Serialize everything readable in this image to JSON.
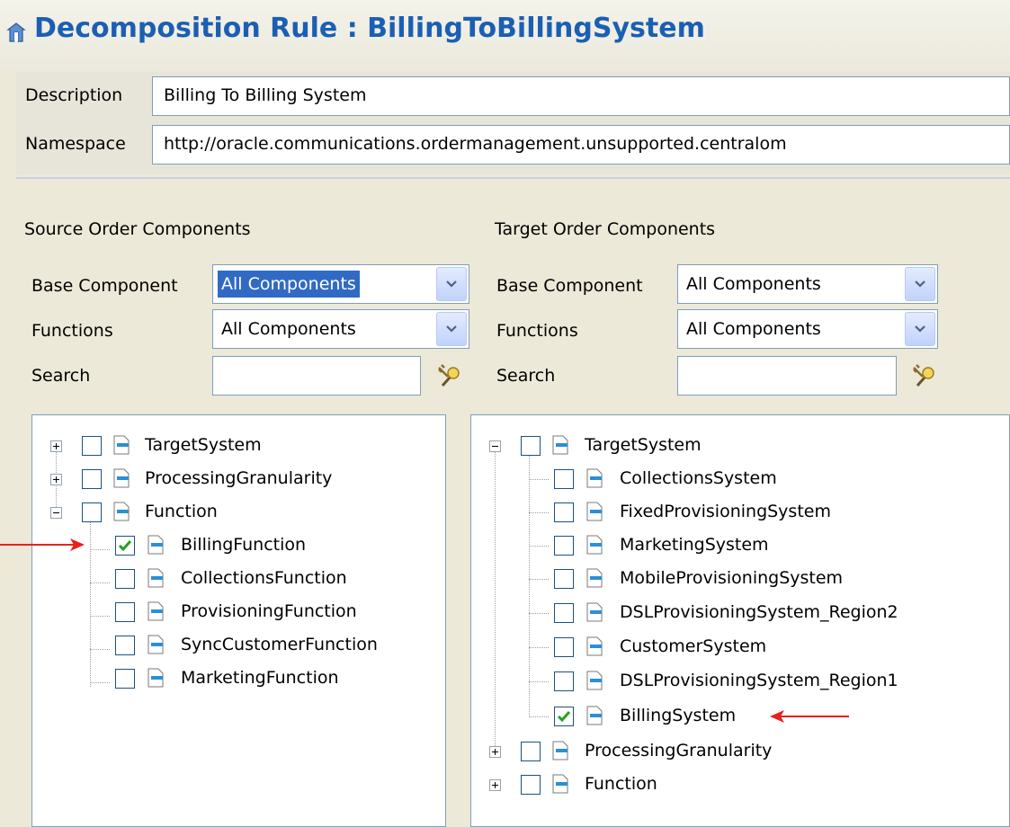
{
  "header": {
    "title": "Decomposition Rule : BillingToBillingSystem",
    "title_icon": "decomposition-rule-icon",
    "title_color": "#1b5fb4"
  },
  "form": {
    "description_label": "Description",
    "description_value": "Billing To Billing System",
    "namespace_label": "Namespace",
    "namespace_value": "http://oracle.communications.ordermanagement.unsupported.centralom"
  },
  "source": {
    "heading": "Source Order Components",
    "base_component_label": "Base Component",
    "base_component_value": "All Components",
    "functions_label": "Functions",
    "functions_value": "All Components",
    "search_label": "Search",
    "search_value": "",
    "tree": [
      {
        "label": "TargetSystem",
        "expanded": false,
        "checked": false
      },
      {
        "label": "ProcessingGranularity",
        "expanded": false,
        "checked": false
      },
      {
        "label": "Function",
        "expanded": true,
        "checked": false,
        "children": [
          {
            "label": "BillingFunction",
            "checked": true
          },
          {
            "label": "CollectionsFunction",
            "checked": false
          },
          {
            "label": "ProvisioningFunction",
            "checked": false
          },
          {
            "label": "SyncCustomerFunction",
            "checked": false
          },
          {
            "label": "MarketingFunction",
            "checked": false
          }
        ]
      }
    ]
  },
  "target": {
    "heading": "Target Order Components",
    "base_component_label": "Base Component",
    "base_component_value": "All Components",
    "functions_label": "Functions",
    "functions_value": "All Components",
    "search_label": "Search",
    "search_value": "",
    "tree": [
      {
        "label": "TargetSystem",
        "expanded": true,
        "checked": false,
        "children": [
          {
            "label": "CollectionsSystem",
            "checked": false
          },
          {
            "label": "FixedProvisioningSystem",
            "checked": false
          },
          {
            "label": "MarketingSystem",
            "checked": false
          },
          {
            "label": "MobileProvisioningSystem",
            "checked": false
          },
          {
            "label": "DSLProvisioningSystem_Region2",
            "checked": false
          },
          {
            "label": "CustomerSystem",
            "checked": false
          },
          {
            "label": "DSLProvisioningSystem_Region1",
            "checked": false
          },
          {
            "label": "BillingSystem",
            "checked": true
          }
        ]
      },
      {
        "label": "ProcessingGranularity",
        "expanded": false,
        "checked": false
      },
      {
        "label": "Function",
        "expanded": false,
        "checked": false
      }
    ]
  },
  "colors": {
    "annotation_arrow": "#e8211c",
    "check": "#21a121",
    "doc_icon_accent": "#2a8fd6"
  }
}
